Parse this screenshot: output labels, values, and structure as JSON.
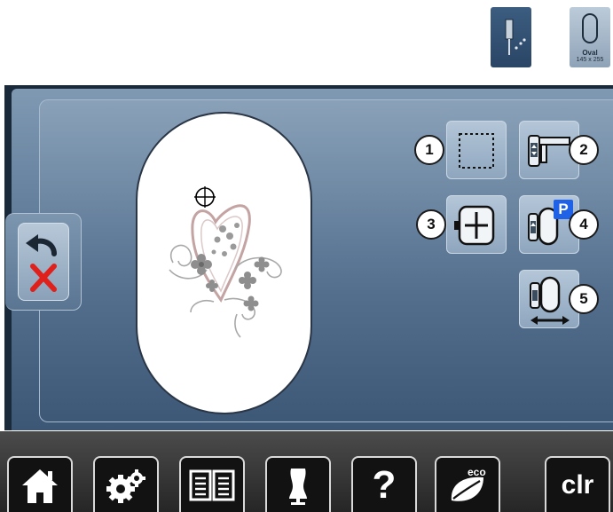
{
  "top_preview": {
    "needle_icon": "needle-position-icon",
    "hoop_icon": "oval-hoop-icon",
    "hoop_name": "Oval",
    "hoop_size": "145 x 255"
  },
  "embroidery_area": {
    "design_icon": "heart-flowers-design",
    "cursor_icon": "crosshair-icon"
  },
  "back_button": {
    "icons": [
      "undo-arrow-icon",
      "cancel-x-icon"
    ]
  },
  "function_buttons": [
    {
      "number": "1",
      "icon": "dashed-frame-icon"
    },
    {
      "number": "2",
      "icon": "hoop-arm-icon"
    },
    {
      "number": "3",
      "icon": "hoop-center-icon"
    },
    {
      "number": "4",
      "icon": "park-position-icon",
      "tag": "P"
    },
    {
      "number": "5",
      "icon": "hoop-move-horizontal-icon"
    }
  ],
  "toolbar": {
    "items": [
      {
        "name": "home",
        "icon": "home-icon"
      },
      {
        "name": "settings",
        "icon": "settings-gears-icon"
      },
      {
        "name": "tutorial",
        "icon": "book-icon"
      },
      {
        "name": "advisor",
        "icon": "dress-form-icon"
      },
      {
        "name": "help",
        "icon": "help-icon",
        "glyph": "?"
      },
      {
        "name": "eco",
        "icon": "eco-leaf-icon",
        "label": "eco"
      },
      {
        "name": "clear",
        "icon": "",
        "label": "clr"
      }
    ]
  },
  "colors": {
    "panel_top": "#7f99b3",
    "panel_bottom": "#3c5676",
    "badge_p": "#1f62e8",
    "cancel_red": "#e0201b",
    "bottom_bar": "#262626"
  }
}
